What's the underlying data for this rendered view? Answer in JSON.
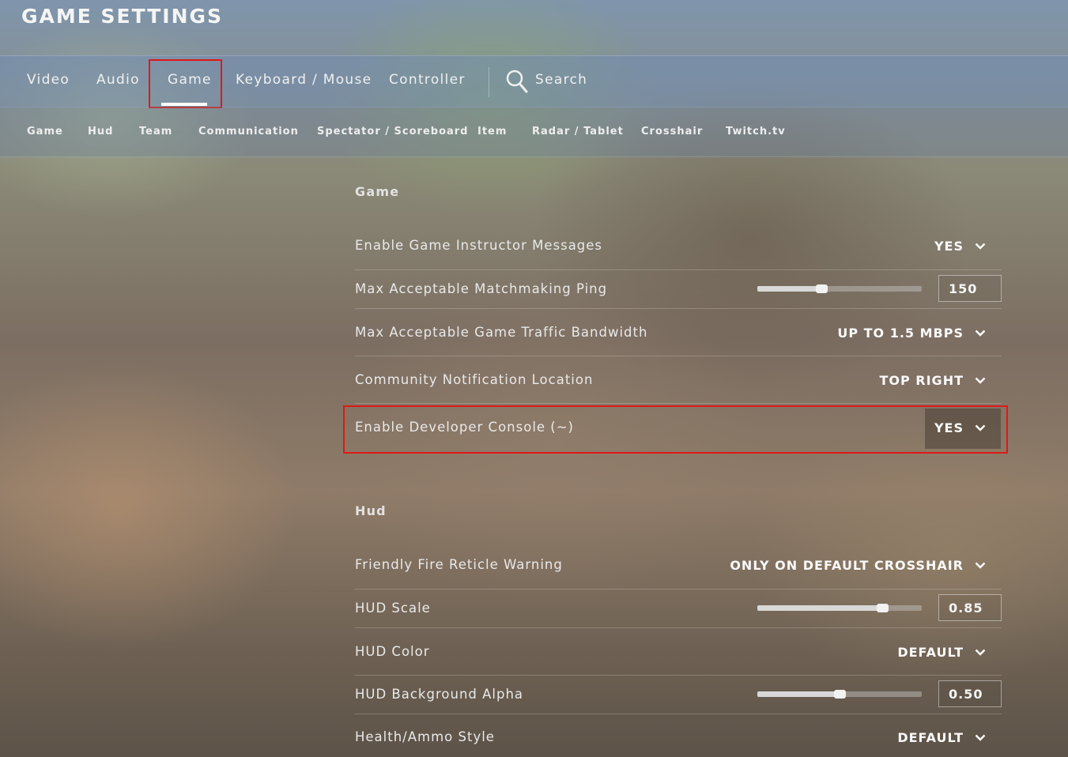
{
  "header": {
    "title": "GAME SETTINGS"
  },
  "tabs": [
    {
      "label": "Video"
    },
    {
      "label": "Audio"
    },
    {
      "label": "Game",
      "active": true
    },
    {
      "label": "Keyboard / Mouse"
    },
    {
      "label": "Controller"
    }
  ],
  "search": {
    "label": "Search",
    "icon": "search-icon"
  },
  "subtabs": [
    {
      "label": "Game"
    },
    {
      "label": "Hud"
    },
    {
      "label": "Team"
    },
    {
      "label": "Communication"
    },
    {
      "label": "Spectator / Scoreboard"
    },
    {
      "label": "Item"
    },
    {
      "label": "Radar / Tablet"
    },
    {
      "label": "Crosshair"
    },
    {
      "label": "Twitch.tv"
    }
  ],
  "game_section": {
    "title": "Game",
    "settings": [
      {
        "label": "Enable Game Instructor Messages",
        "type": "dropdown",
        "value": "YES"
      },
      {
        "label": "Max Acceptable Matchmaking Ping",
        "type": "slider",
        "value": "150",
        "fraction": 0.39
      },
      {
        "label": "Max Acceptable Game Traffic Bandwidth",
        "type": "dropdown",
        "value": "UP TO 1.5 MBPS"
      },
      {
        "label": "Community Notification Location",
        "type": "dropdown",
        "value": "TOP RIGHT"
      },
      {
        "label": "Enable Developer Console (~)",
        "type": "dropdown",
        "value": "YES",
        "highlighted": true
      }
    ]
  },
  "hud_section": {
    "title": "Hud",
    "settings": [
      {
        "label": "Friendly Fire Reticle Warning",
        "type": "dropdown",
        "value": "ONLY ON DEFAULT CROSSHAIR"
      },
      {
        "label": "HUD Scale",
        "type": "slider",
        "value": "0.85",
        "fraction": 0.76
      },
      {
        "label": "HUD Color",
        "type": "dropdown",
        "value": "DEFAULT"
      },
      {
        "label": "HUD Background Alpha",
        "type": "slider",
        "value": "0.50",
        "fraction": 0.5
      },
      {
        "label": "Health/Ammo Style",
        "type": "dropdown",
        "value": "DEFAULT"
      }
    ]
  },
  "colors": {
    "highlight": "#e01818",
    "text": "#e9e9e9"
  }
}
